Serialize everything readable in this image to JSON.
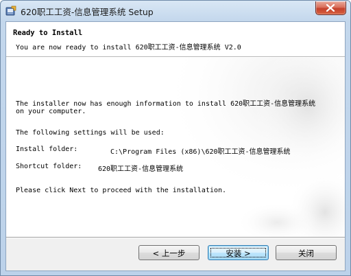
{
  "window": {
    "title": "620职工工资-信息管理系统 Setup",
    "icon": "installer-icon",
    "close_icon": "close-icon"
  },
  "header": {
    "title": "Ready to Install",
    "subtitle": "You are now ready to install 620职工工资-信息管理系统 V2.0"
  },
  "content": {
    "intro": "The installer now has enough information to install 620职工工资-信息管理系统\non your computer.",
    "settings_heading": "The following settings will be used:",
    "install_folder_label": "Install folder:",
    "install_folder_value": "C:\\Program Files (x86)\\620职工工资-信息管理系统",
    "shortcut_folder_label": "Shortcut folder:",
    "shortcut_folder_value": "620职工工资-信息管理系统",
    "proceed": "Please click Next to proceed with the installation."
  },
  "buttons": {
    "back": "< 上一步",
    "install": "安装 >",
    "close": "关闭"
  },
  "colors": {
    "title_bar": "#c3d7ec",
    "close_button": "#c4412c",
    "default_button_border": "#3c7fb1",
    "footer_bg": "#f0f0f0"
  }
}
